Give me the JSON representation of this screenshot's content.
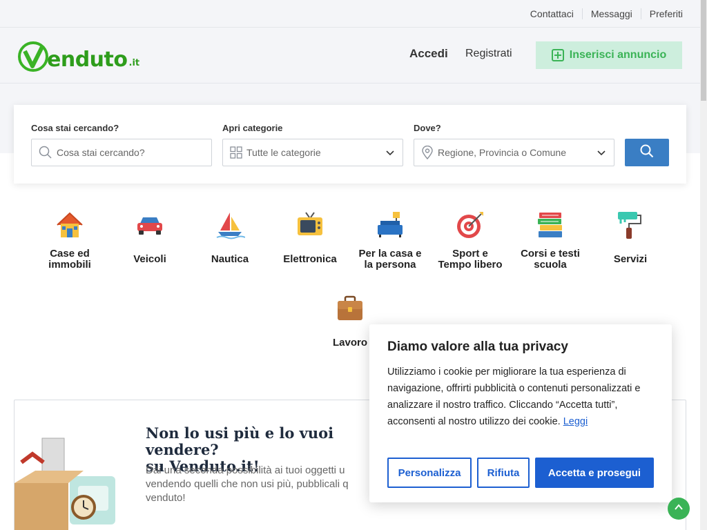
{
  "topbar": {
    "links": [
      "Contattaci",
      "Messaggi",
      "Preferiti"
    ]
  },
  "header": {
    "logo_text": "enduto",
    "logo_tld": ".it",
    "login": "Accedi",
    "register": "Registrati",
    "add_listing": "Inserisci annuncio"
  },
  "search": {
    "what_label": "Cosa stai cercando?",
    "what_placeholder": "Cosa stai cercando?",
    "category_label": "Apri categorie",
    "category_value": "Tutte le categorie",
    "where_label": "Dove?",
    "where_value": "Regione, Provincia o Comune"
  },
  "categories": [
    {
      "label1": "Case ed",
      "label2": "immobili",
      "icon": "house-icon"
    },
    {
      "label1": "Veicoli",
      "label2": "",
      "icon": "car-icon"
    },
    {
      "label1": "Nautica",
      "label2": "",
      "icon": "sailboat-icon"
    },
    {
      "label1": "Elettronica",
      "label2": "",
      "icon": "tv-icon"
    },
    {
      "label1": "Per la casa e",
      "label2": "la persona",
      "icon": "sofa-icon"
    },
    {
      "label1": "Sport e",
      "label2": "Tempo libero",
      "icon": "target-icon"
    },
    {
      "label1": "Corsi e testi",
      "label2": "scuola",
      "icon": "books-icon"
    },
    {
      "label1": "Servizi",
      "label2": "",
      "icon": "paint-roller-icon"
    },
    {
      "label1": "Lavoro",
      "label2": "",
      "icon": "briefcase-icon"
    }
  ],
  "promo": {
    "title_line1": "Non lo usi più e lo vuoi vendere?",
    "title_line2": "su Venduto.it!",
    "text": "Dài una seconda possibilità ai tuoi oggetti u vendendo quelli che non usi più, pubblicali q venduto!"
  },
  "cookie": {
    "title": "Diamo valore alla tua privacy",
    "text": "Utilizziamo i cookie per migliorare la tua esperienza di navigazione, offrirti pubblicità o contenuti personalizzati e analizzare il nostro traffico. Cliccando “Accetta tutti”, acconsenti al nostro utilizzo dei cookie.",
    "read_more": "Leggi",
    "customize": "Personalizza",
    "reject": "Rifiuta",
    "accept": "Accetta e prosegui"
  },
  "colors": {
    "brand_green": "#3ab326",
    "search_blue": "#3a7ec4",
    "cookie_blue": "#1c5fd1"
  }
}
